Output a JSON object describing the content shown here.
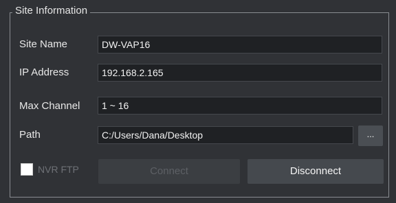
{
  "group": {
    "title": "Site Information"
  },
  "site_name": {
    "label": "Site Name",
    "value": "DW-VAP16"
  },
  "ip_address": {
    "label": "IP Address",
    "value": "192.168.2.165"
  },
  "max_channel": {
    "label": "Max Channel",
    "value": "1 ~ 16"
  },
  "path": {
    "label": "Path",
    "value": "C:/Users/Dana/Desktop",
    "browse_label": "..."
  },
  "nvr_ftp": {
    "label": "NVR FTP",
    "checked": false,
    "enabled": false
  },
  "buttons": {
    "connect_label": "Connect",
    "connect_enabled": false,
    "disconnect_label": "Disconnect",
    "disconnect_enabled": true
  },
  "colors": {
    "background": "#303236",
    "field_background": "#1f2124",
    "disabled_text": "#5d6065",
    "button": "#45494e"
  }
}
